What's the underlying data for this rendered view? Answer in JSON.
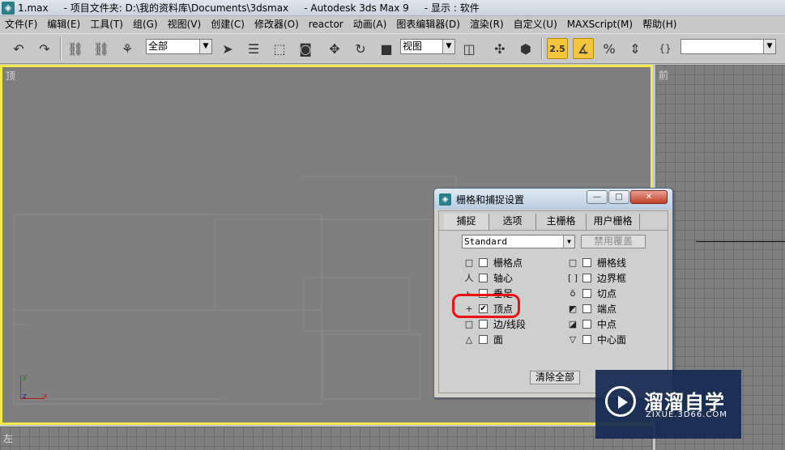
{
  "titlebar": {
    "text": "1.max     - 项目文件夹: D:\\我的资料库\\Documents\\3dsmax     - Autodesk 3ds Max 9     - 显示 : 软件"
  },
  "menu": [
    "文件(F)",
    "编辑(E)",
    "工具(T)",
    "组(G)",
    "视图(V)",
    "创建(C)",
    "修改器(O)",
    "reactor",
    "动画(A)",
    "图表编辑器(D)",
    "渲染(R)",
    "自定义(U)",
    "MAXScript(M)",
    "帮助(H)"
  ],
  "toolbar": {
    "selection_filter": "全部",
    "ref_coord": "视图",
    "snap_toggle_label": "2.5",
    "named_selection": ""
  },
  "viewports": {
    "top": "顶",
    "front": "前",
    "bottom_left": "左"
  },
  "axes": {
    "y": "y",
    "z": "z",
    "x": "x"
  },
  "dialog": {
    "title": "栅格和捕捉设置",
    "tabs": [
      "捕捉",
      "选项",
      "主栅格",
      "用户栅格"
    ],
    "active_tab": "捕捉",
    "preset": "Standard",
    "override_button": "禁用覆盖",
    "left_options": [
      {
        "icon": "□",
        "label": "栅格点",
        "checked": false
      },
      {
        "icon": "人",
        "label": "轴心",
        "checked": false
      },
      {
        "icon": "ь",
        "label": "垂足",
        "checked": false
      },
      {
        "icon": "+",
        "label": "顶点",
        "checked": true
      },
      {
        "icon": "□",
        "label": "边/线段",
        "checked": false
      },
      {
        "icon": "△",
        "label": "面",
        "checked": false
      }
    ],
    "right_options": [
      {
        "icon": "□",
        "label": "栅格线",
        "checked": false
      },
      {
        "icon": "[ ]",
        "label": "边界框",
        "checked": false
      },
      {
        "icon": "ō",
        "label": "切点",
        "checked": false
      },
      {
        "icon": "◩",
        "label": "端点",
        "checked": false
      },
      {
        "icon": "◪",
        "label": "中点",
        "checked": false
      },
      {
        "icon": "▽",
        "label": "中心面",
        "checked": false
      }
    ],
    "clear_button": "清除全部"
  },
  "watermark": {
    "title": "溜溜自学",
    "url": "ZIXUE.3D66.COM"
  },
  "colors": {
    "active_viewport_border": "#f3e84c",
    "highlight_circle": "#ee1111",
    "snap_active": "#f2c43a"
  }
}
